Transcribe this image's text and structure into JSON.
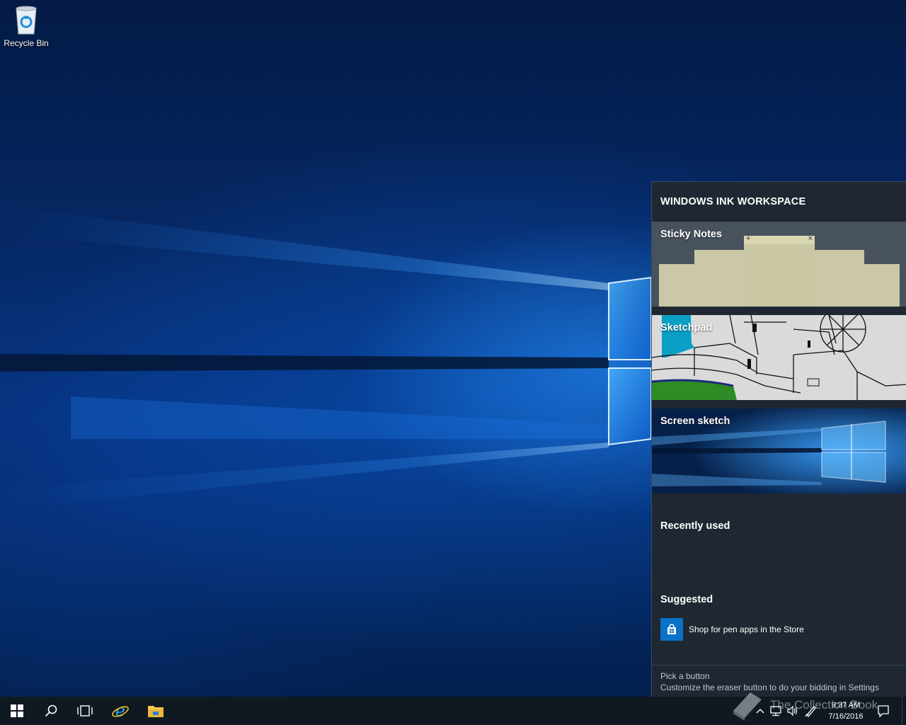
{
  "desktop": {
    "icons": [
      {
        "label": "Recycle Bin",
        "icon": "recycle-bin-icon"
      }
    ]
  },
  "ink_workspace": {
    "title": "WINDOWS INK WORKSPACE",
    "tiles": {
      "sticky_notes": "Sticky Notes",
      "sketchpad": "Sketchpad",
      "screen_sketch": "Screen sketch"
    },
    "note_plus": "+",
    "note_close": "×",
    "recently_used": "Recently used",
    "suggested": "Suggested",
    "store_link": "Shop for pen apps in the Store",
    "footer": {
      "title": "Pick a button",
      "text": "Customize the eraser button to do your bidding in Settings"
    },
    "colors": {
      "panel_bg": "#1f2832",
      "note": "#cac8a6",
      "store_tile": "#0a72c8"
    }
  },
  "taskbar": {
    "buttons": [
      "start-icon",
      "search-icon",
      "task-view-icon",
      "internet-explorer-icon",
      "file-explorer-icon"
    ],
    "tray": [
      "chevron-up-icon",
      "network-icon",
      "volume-icon",
      "pen-icon",
      "action-center-icon"
    ],
    "time": "9:37 AM",
    "date": "7/16/2016"
  },
  "watermark": {
    "text": "The Collection Book"
  }
}
